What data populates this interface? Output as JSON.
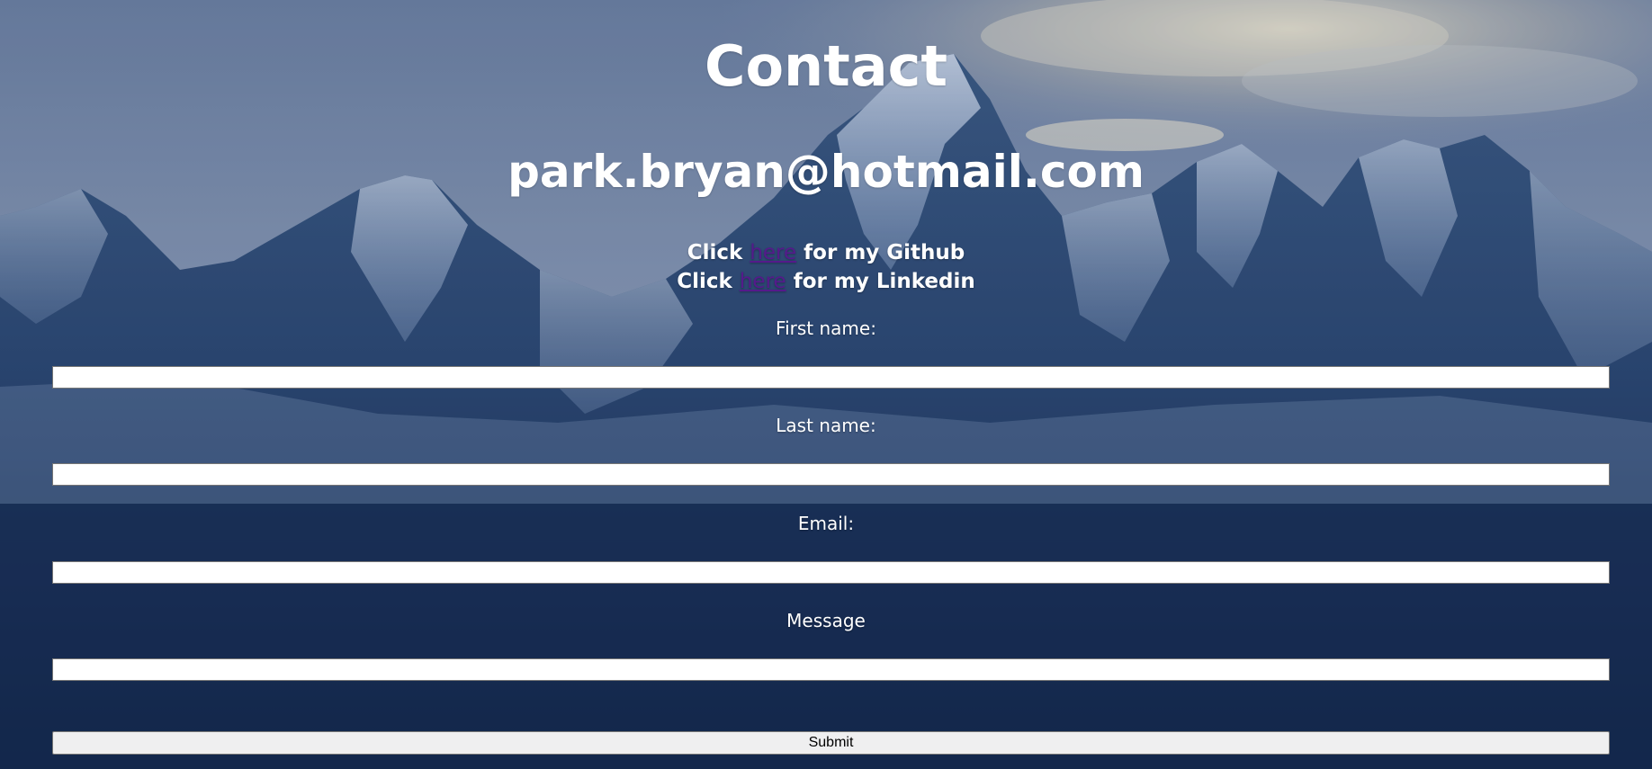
{
  "page": {
    "title": "Contact",
    "email": "park.bryan@hotmail.com"
  },
  "links": {
    "github": {
      "prefix": "Click ",
      "link_text": "here",
      "suffix": " for my Github"
    },
    "linkedin": {
      "prefix": "Click ",
      "link_text": "here",
      "suffix": " for my Linkedin"
    },
    "link_color": "#551a8b"
  },
  "form": {
    "first_name_label": "First name:",
    "first_name_value": "",
    "last_name_label": "Last name:",
    "last_name_value": "",
    "email_label": "Email:",
    "email_value": "",
    "message_label": "Message",
    "message_value": "",
    "submit_label": "Submit"
  },
  "background": {
    "subject": "snow-covered mountain range under cloudy sky",
    "sky_color": "#7d8faa",
    "mountain_color": "#1d3356"
  }
}
